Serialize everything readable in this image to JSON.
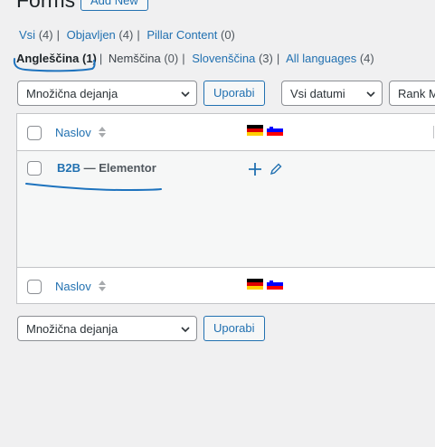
{
  "page": {
    "title": "Forms",
    "add_new": "Add New"
  },
  "status_links": [
    {
      "label": "Vsi",
      "count": "(4)"
    },
    {
      "label": "Objavljen",
      "count": "(4)"
    },
    {
      "label": "Pillar Content",
      "count": "(0)"
    }
  ],
  "language_links": [
    {
      "label": "Angleščina",
      "count": "(1)"
    },
    {
      "label": "Nemščina",
      "count": "(0)"
    },
    {
      "label": "Slovenščina",
      "count": "(3)"
    },
    {
      "label": "All languages",
      "count": "(4)"
    }
  ],
  "filters_top": {
    "bulk_actions": "Množična dejanja",
    "apply": "Uporabi",
    "dates": "Vsi datumi",
    "rank": "Rank M"
  },
  "table": {
    "column_title": "Naslov",
    "rows": [
      {
        "title": "B2B",
        "suffix": " — Elementor"
      }
    ]
  },
  "filters_bottom": {
    "bulk_actions": "Množična dejanja",
    "apply": "Uporabi"
  },
  "colors": {
    "link": "#2271b1",
    "annotation": "#1e73be"
  }
}
